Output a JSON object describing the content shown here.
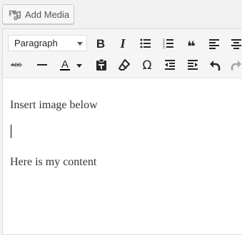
{
  "media": {
    "add_media_label": "Add Media",
    "icon": "add-media-icon"
  },
  "toolbar": {
    "format_select": {
      "selected": "Paragraph",
      "options": [
        "Paragraph"
      ]
    },
    "row1": [
      "bold-icon",
      "italic-icon",
      "bullet-list-icon",
      "numbered-list-icon",
      "blockquote-icon",
      "align-left-icon",
      "align-center-icon"
    ],
    "row2": [
      "strikethrough-icon",
      "horizontal-line-icon",
      "text-color-icon",
      "paste-as-text-icon",
      "clear-formatting-icon",
      "special-character-icon",
      "decrease-indent-icon",
      "increase-indent-icon",
      "undo-icon",
      "redo-icon"
    ],
    "strikethrough_label": "ABC",
    "bold_label": "B",
    "italic_label": "I",
    "text_color_label": "A",
    "special_char_label": "Ω",
    "quote_label": "❝",
    "colors": {
      "text_color_underline": "#000000",
      "icon": "#23282d",
      "disabled": "#a0a5aa"
    }
  },
  "content": {
    "paragraphs": [
      "Insert image below",
      "Here is my content"
    ]
  }
}
